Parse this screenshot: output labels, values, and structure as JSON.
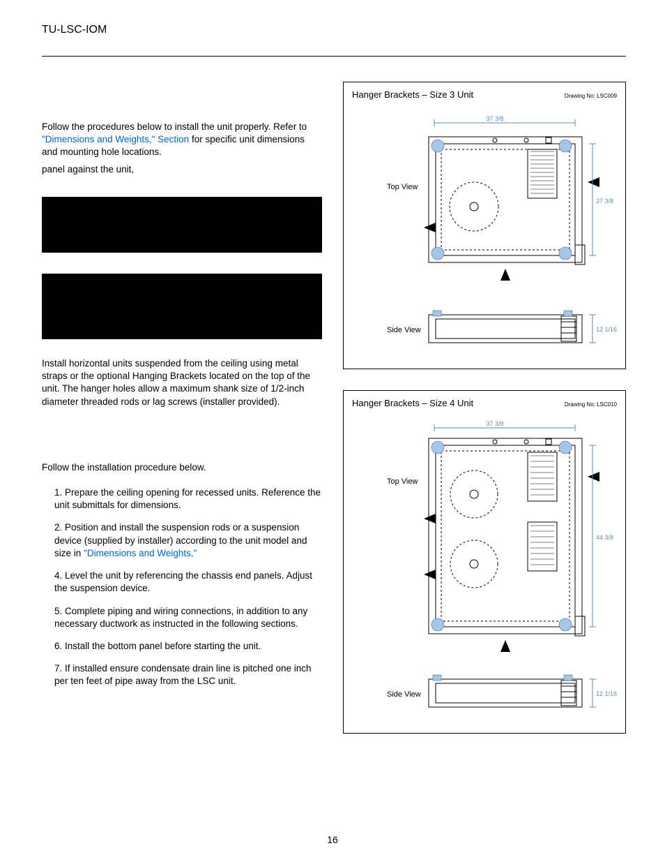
{
  "header": {
    "doc_code": "TU-LSC-IOM"
  },
  "intro": {
    "line1_a": "Follow the procedures below to install the unit properly. Refer to ",
    "link1": "\"Dimensions and Weights,\" Section",
    "line1_b": " for specific unit dimensions and mounting hole locations.",
    "line2": " panel against the unit,"
  },
  "para_suspend": "Install horizontal units suspended from the ceiling using metal straps or the optional Hanging Brackets  located on the top of the unit. The hanger holes allow a maximum shank size of 1/2-inch diameter threaded rods or lag screws (installer provided).",
  "para_follow": "Follow the installation procedure below.",
  "steps": {
    "s1": "1. Prepare the ceiling opening for recessed units. Reference the unit submittals for dimensions.",
    "s2a": "2. Position and install the suspension rods or a suspension device (supplied by installer) according to the unit model and size in ",
    "s2_link": "\"Dimensions and Weights,\"",
    "s4": "4. Level the unit by referencing the chassis end panels. Adjust the suspension device.",
    "s5": "5. Complete piping and wiring connections, in addition to any necessary ductwork as instructed in the following sections.",
    "s6": "6. Install the bottom panel before starting the unit.",
    "s7": "7. If installed ensure condensate drain line is pitched one inch per ten feet of pipe away from the LSC unit."
  },
  "figures": {
    "f1": {
      "caption": "Hanger Brackets – Size 3 Unit",
      "drawing_no": "Drawing No: LSC009",
      "top_view": "Top View",
      "side_view": "Side View",
      "dim_w": "37 3/8",
      "dim_h": "27 3/8",
      "dim_side": "12 1/16"
    },
    "f2": {
      "caption": "Hanger Brackets – Size 4 Unit",
      "drawing_no": "Drawing No: LSC010",
      "top_view": "Top View",
      "side_view": "Side View",
      "dim_w": "37 3/8",
      "dim_h": "44 3/8",
      "dim_side": "12 1/16"
    }
  },
  "page_number": "16"
}
